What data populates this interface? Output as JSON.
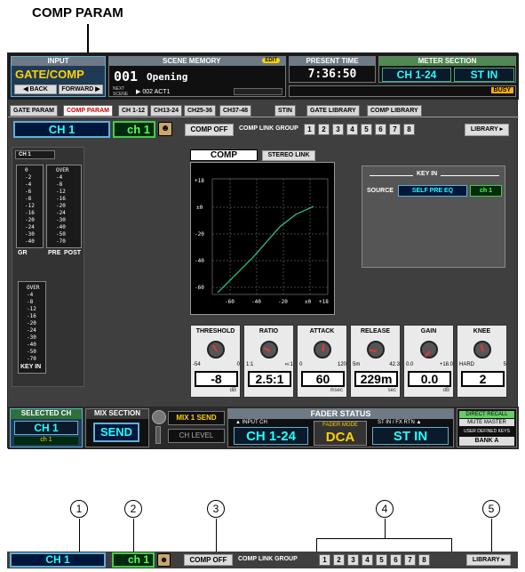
{
  "callout_title": "COMP PARAM",
  "topbar": {
    "input_hdr": "INPUT",
    "input_title": "GATE/COMP",
    "back": "◀ BACK",
    "forward": "FORWARD ▶",
    "scene_hdr": "SCENE MEMORY",
    "scene_badge": "EDIT",
    "scene_number": "001",
    "scene_title": "Opening",
    "next_label": "NEXT SCENE",
    "next_scene": "▶ 002 ACT1",
    "time_hdr": "PRESENT TIME",
    "time": "7:36:50",
    "meter_hdr": "METER SECTION",
    "meter_left": "CH 1-24",
    "meter_right": "ST IN",
    "busy": "BUSY"
  },
  "tabs": [
    "GATE PARAM",
    "COMP PARAM",
    "CH 1-12",
    "CH13-24",
    "CH25-36",
    "CH37-48",
    "STIN",
    "GATE LIBRARY",
    "COMP LIBRARY"
  ],
  "channel": {
    "id": "CH 1",
    "name": "ch 1"
  },
  "comp_off": "COMP OFF",
  "link_group_label": "COMP LINK GROUP",
  "link_group": [
    "1",
    "2",
    "3",
    "4",
    "5",
    "6",
    "7",
    "8"
  ],
  "library": "LIBRARY ▸",
  "meters": {
    "ch_label": "CH 1",
    "gr_scale": [
      "0",
      "-2",
      "-4",
      "-6",
      "-8",
      "-12",
      "-16",
      "-20",
      "-24",
      "-30",
      "-40"
    ],
    "pre_scale": [
      "OVER",
      "-4",
      "-8",
      "-12",
      "-16",
      "-20",
      "-24",
      "-30",
      "-40",
      "-50",
      "-70"
    ],
    "gr": "GR",
    "pre": "PRE",
    "post": "POST",
    "key_scale": [
      "OVER",
      "-4",
      "-8",
      "-12",
      "-16",
      "-20",
      "-24",
      "-30",
      "-40",
      "-50",
      "-70"
    ],
    "key_in": "KEY IN"
  },
  "comp_title": "COMP",
  "stereo_link": "STEREO LINK",
  "graph": {
    "y_ticks": [
      "+18",
      "±0",
      "-20",
      "-40",
      "-60"
    ],
    "x_ticks": [
      "-60",
      "-40",
      "-20",
      "±0",
      "+18"
    ]
  },
  "key_in_box": {
    "title": "KEY IN",
    "source_label": "SOURCE",
    "source": "SELF PRE EQ",
    "channel": "ch 1"
  },
  "params": [
    {
      "title": "THRESHOLD",
      "min": "-54",
      "max": "0",
      "value": "-8",
      "unit": "dB"
    },
    {
      "title": "RATIO",
      "min": "1:1",
      "max": "∞:1",
      "value": "2.5:1",
      "unit": ""
    },
    {
      "title": "ATTACK",
      "min": "0",
      "max": "120",
      "value": "60",
      "unit": "msec"
    },
    {
      "title": "RELEASE",
      "min": "5m",
      "max": "42.3",
      "value": "229m",
      "unit": "sec"
    },
    {
      "title": "GAIN",
      "min": "0.0",
      "max": "+18.0",
      "value": "0.0",
      "unit": "dB"
    },
    {
      "title": "KNEE",
      "min": "HARD",
      "max": "5",
      "value": "2",
      "unit": ""
    }
  ],
  "bottom": {
    "sel_hdr": "SELECTED CH",
    "sel_ch": "CH 1",
    "sel_name": "ch 1",
    "mix_hdr": "MIX SECTION",
    "send": "SEND",
    "mix_send": "MIX 1 SEND",
    "ch_level": "CH LEVEL",
    "fader_hdr": "FADER STATUS",
    "input_ch_lbl": "▲ INPUT CH",
    "input_ch": "CH 1-24",
    "fader_mode_lbl": "FADER MODE",
    "fader_mode": "DCA",
    "st_lbl": "ST IN / FX RTN ▲",
    "st_in": "ST IN",
    "direct_recall": "DIRECT RECALL",
    "mute_master": "MUTE MASTER",
    "user_keys": "USER DEFINED KEYS",
    "bank": "BANK A"
  },
  "callouts": [
    "1",
    "2",
    "3",
    "4",
    "5"
  ]
}
